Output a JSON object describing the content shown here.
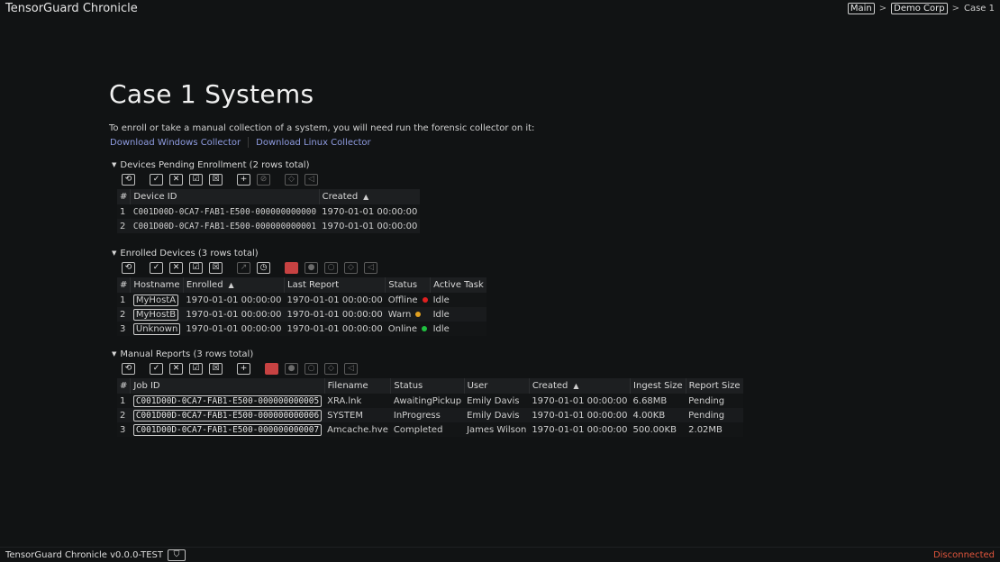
{
  "app": {
    "title": "TensorGuard Chronicle"
  },
  "breadcrumb": {
    "main": "Main",
    "org": "Demo Corp",
    "case": "Case 1",
    "sep": ">"
  },
  "page": {
    "title": "Case 1 Systems",
    "intro": "To enroll or take a manual collection of a system, you will need run the forensic collector on it:",
    "download_windows": "Download Windows Collector",
    "download_linux": "Download Linux Collector"
  },
  "pending": {
    "title": "Devices Pending Enrollment (2 rows total)",
    "columns": [
      "#",
      "Device ID",
      "Created"
    ],
    "rows": [
      {
        "n": "1",
        "device_id": "C001D00D-0CA7-FAB1-E500-000000000000",
        "created": "1970-01-01 00:00:00"
      },
      {
        "n": "2",
        "device_id": "C001D00D-0CA7-FAB1-E500-000000000001",
        "created": "1970-01-01 00:00:00"
      }
    ]
  },
  "enrolled": {
    "title": "Enrolled Devices (3 rows total)",
    "columns": [
      "#",
      "Hostname",
      "Enrolled",
      "Last Report",
      "Status",
      "Active Task"
    ],
    "rows": [
      {
        "n": "1",
        "hostname": "MyHostA",
        "enrolled": "1970-01-01 00:00:00",
        "last_report": "1970-01-01 00:00:00",
        "status": "Offline",
        "status_color": "#e02020",
        "task": "Idle"
      },
      {
        "n": "2",
        "hostname": "MyHostB",
        "enrolled": "1970-01-01 00:00:00",
        "last_report": "1970-01-01 00:00:00",
        "status": "Warn",
        "status_color": "#e0a020",
        "task": "Idle"
      },
      {
        "n": "3",
        "hostname": "Unknown",
        "enrolled": "1970-01-01 00:00:00",
        "last_report": "1970-01-01 00:00:00",
        "status": "Online",
        "status_color": "#20c040",
        "task": "Idle"
      }
    ]
  },
  "reports": {
    "title": "Manual Reports (3 rows total)",
    "columns": [
      "#",
      "Job ID",
      "Filename",
      "Status",
      "User",
      "Created",
      "Ingest Size",
      "Report Size"
    ],
    "rows": [
      {
        "n": "1",
        "job_id": "C001D00D-0CA7-FAB1-E500-000000000005",
        "filename": "XRA.lnk",
        "status": "AwaitingPickup",
        "user": "Emily Davis",
        "created": "1970-01-01 00:00:00",
        "ingest": "6.68MB",
        "report": "Pending"
      },
      {
        "n": "2",
        "job_id": "C001D00D-0CA7-FAB1-E500-000000000006",
        "filename": "SYSTEM",
        "status": "InProgress",
        "user": "Emily Davis",
        "created": "1970-01-01 00:00:00",
        "ingest": "4.00KB",
        "report": "Pending"
      },
      {
        "n": "3",
        "job_id": "C001D00D-0CA7-FAB1-E500-000000000007",
        "filename": "Amcache.hve",
        "status": "Completed",
        "user": "James Wilson",
        "created": "1970-01-01 00:00:00",
        "ingest": "500.00KB",
        "report": "2.02MB"
      }
    ]
  },
  "icons": {
    "refresh": "⟲",
    "select_all": "✓",
    "deselect": "✕",
    "check_box": "☑",
    "x_box": "☒",
    "add": "+",
    "ban": "⊘",
    "tag": "◇",
    "untag": "◁",
    "clock": "◷",
    "export": "↗",
    "record": "●",
    "circle": "○",
    "sort_asc": "▲",
    "caret": "▼",
    "shield": "⛉"
  },
  "accent": {
    "red": "#c74242",
    "link": "#8e9be0",
    "disconnected": "#e0553c"
  },
  "footer": {
    "version": "TensorGuard Chronicle v0.0.0-TEST",
    "status": "Disconnected"
  }
}
